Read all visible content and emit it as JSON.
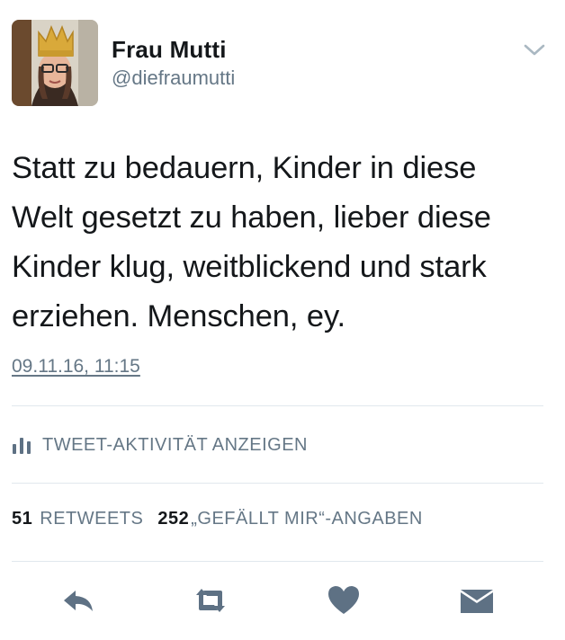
{
  "user": {
    "name": "Frau Mutti",
    "handle": "@diefraumutti"
  },
  "tweet": {
    "lines": [
      "Statt zu bedauern, Kinder in diese",
      "Welt gesetzt zu haben, lieber diese",
      "Kinder klug, weitblickend und stark",
      "erziehen. Menschen, ey."
    ],
    "timestamp": "09.11.16, 11:15"
  },
  "activity": {
    "label": "TWEET-AKTIVITÄT ANZEIGEN"
  },
  "stats": {
    "retweets_count": "51",
    "retweets_label": "RETWEETS",
    "likes_count": "252",
    "likes_label": "„GEFÄLLT MIR“-ANGABEN"
  },
  "actions": [
    {
      "icon": "reply-icon"
    },
    {
      "icon": "retweet-icon"
    },
    {
      "icon": "heart-icon"
    },
    {
      "icon": "mail-icon"
    }
  ],
  "colors": {
    "text": "#14171a",
    "secondary": "#657786",
    "icon": "#5e7184",
    "divider": "#e1e8ed",
    "chevron": "#aab8c2"
  }
}
